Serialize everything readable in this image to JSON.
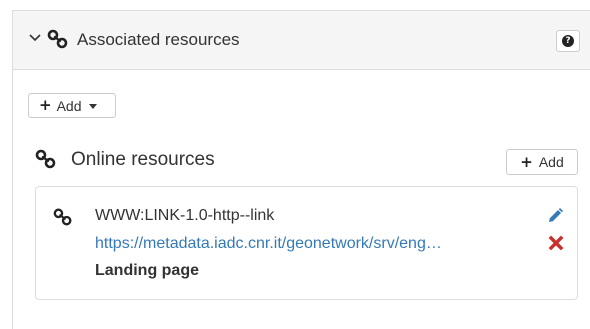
{
  "panel": {
    "title": "Associated resources",
    "help_icon_glyph": "?"
  },
  "add_menu": {
    "label": "Add"
  },
  "online_resources": {
    "title": "Online resources",
    "add_label": "Add",
    "items": [
      {
        "title": "WWW:LINK-1.0-http--link",
        "url": "https://metadata.iadc.cnr.it/geonetwork/srv/eng…",
        "description": "Landing page"
      }
    ]
  },
  "icons": {
    "chevron": "chevron-down-icon",
    "link": "link-icon",
    "help": "question-circle-icon",
    "plus": "plus-icon",
    "caret": "caret-down-icon",
    "edit": "pencil-icon",
    "delete": "close-icon"
  },
  "colors": {
    "header_bg": "#f5f5f5",
    "link": "#337ab7",
    "delete": "#c9302c"
  }
}
